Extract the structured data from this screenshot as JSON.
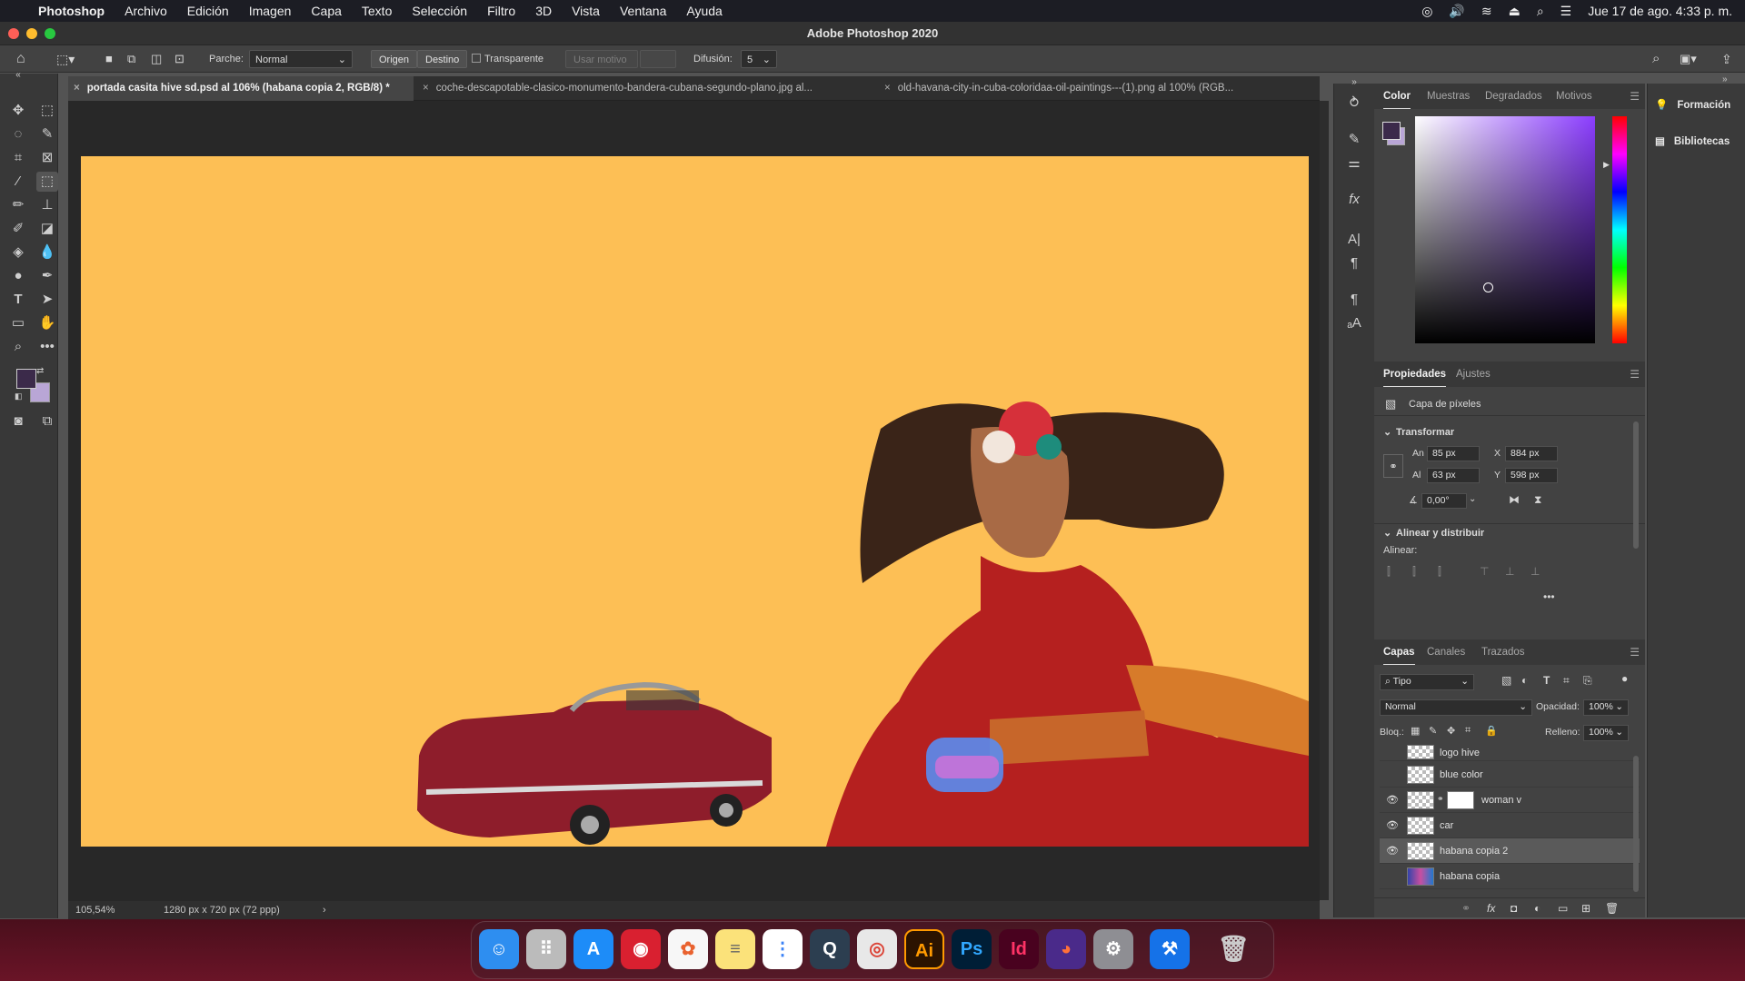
{
  "menubar": {
    "app": "Photoshop",
    "items": [
      "Archivo",
      "Edición",
      "Imagen",
      "Capa",
      "Texto",
      "Selección",
      "Filtro",
      "3D",
      "Vista",
      "Ventana",
      "Ayuda"
    ],
    "datetime": "Jue 17 de ago.  4:33 p. m."
  },
  "window": {
    "title": "Adobe Photoshop 2020"
  },
  "options": {
    "parche_label": "Parche:",
    "parche_value": "Normal",
    "origen": "Origen",
    "destino": "Destino",
    "transparente": "Transparente",
    "usar_motivo": "Usar motivo",
    "difusion_label": "Difusión:",
    "difusion_value": "5"
  },
  "tabs": [
    "portada  casita hive sd.psd al 106% (habana copia 2, RGB/8) *",
    "coche-descapotable-clasico-monumento-bandera-cubana-segundo-plano.jpg al...",
    "old-havana-city-in-cuba-coloridaa-oil-paintings---(1).png al 100% (RGB..."
  ],
  "status": {
    "zoom": "105,54%",
    "doc_size": "1280 px x 720 px (72 ppp)"
  },
  "color_panel": {
    "tabs": [
      "Color",
      "Muestras",
      "Degradados",
      "Motivos"
    ],
    "fg_color": "#3b2a4a",
    "bg_color": "#b9a6d6",
    "picker_hue": "#8b3dff"
  },
  "properties": {
    "tabs": [
      "Propiedades",
      "Ajustes"
    ],
    "layer_type": "Capa de píxeles",
    "transform_title": "Transformar",
    "an_label": "An",
    "an_value": "85 px",
    "x_label": "X",
    "x_value": "884 px",
    "al_label": "Al",
    "al_value": "63 px",
    "y_label": "Y",
    "y_value": "598 px",
    "angle_value": "0,00°",
    "align_title": "Alinear y distribuir",
    "align_label": "Alinear:"
  },
  "layers_panel": {
    "tabs": [
      "Capas",
      "Canales",
      "Trazados"
    ],
    "filter": "Tipo",
    "blend": "Normal",
    "opacity_label": "Opacidad:",
    "opacity_value": "100%",
    "lock_label": "Bloq.:",
    "fill_label": "Relleno:",
    "fill_value": "100%",
    "layers": [
      {
        "name": "logo hive",
        "visible": false,
        "selected": false
      },
      {
        "name": "blue color",
        "visible": false,
        "selected": false
      },
      {
        "name": "woman v",
        "visible": true,
        "selected": false
      },
      {
        "name": "car",
        "visible": true,
        "selected": false
      },
      {
        "name": "habana copia 2",
        "visible": true,
        "selected": true
      },
      {
        "name": "habana copia",
        "visible": false,
        "selected": false
      }
    ]
  },
  "far_right": {
    "formacion": "Formación",
    "bibliotecas": "Bibliotecas"
  },
  "canvas": {
    "background": "#fdbf55"
  },
  "dock": {
    "apps": [
      "finder",
      "launchpad",
      "app-store",
      "photo-booth",
      "photos",
      "notes",
      "reminders",
      "quicktime",
      "chrome",
      "Ai",
      "Ps",
      "Id",
      "firefox",
      "system-settings",
      "xcode",
      "trash"
    ]
  }
}
